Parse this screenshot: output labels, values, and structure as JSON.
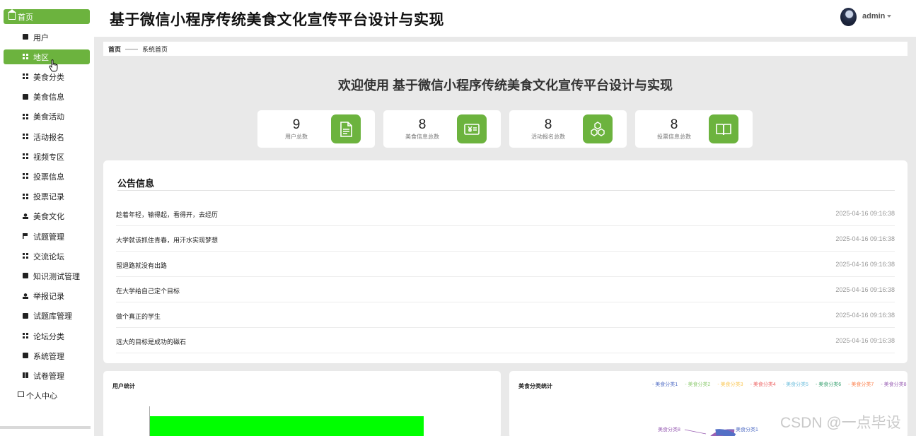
{
  "sidebar": {
    "home": "首页",
    "items": [
      {
        "label": "用户",
        "icon": "person-card-icon",
        "active": false
      },
      {
        "label": "地区",
        "icon": "grid-icon",
        "active": true
      },
      {
        "label": "美食分类",
        "icon": "grid-icon",
        "active": false
      },
      {
        "label": "美食信息",
        "icon": "thumbs-up-icon",
        "active": false
      },
      {
        "label": "美食活动",
        "icon": "grid-icon",
        "active": false
      },
      {
        "label": "活动报名",
        "icon": "grid-icon",
        "active": false
      },
      {
        "label": "视频专区",
        "icon": "grid-icon",
        "active": false
      },
      {
        "label": "投票信息",
        "icon": "grid-icon",
        "active": false
      },
      {
        "label": "投票记录",
        "icon": "grid-icon",
        "active": false
      },
      {
        "label": "美食文化",
        "icon": "user-icon",
        "active": false
      },
      {
        "label": "试题管理",
        "icon": "flag-icon",
        "active": false
      },
      {
        "label": "交流论坛",
        "icon": "grid-icon",
        "active": false
      },
      {
        "label": "知识测试管理",
        "icon": "clipboard-icon",
        "active": false
      },
      {
        "label": "举报记录",
        "icon": "user-stamp-icon",
        "active": false
      },
      {
        "label": "试题库管理",
        "icon": "database-icon",
        "active": false
      },
      {
        "label": "论坛分类",
        "icon": "grid-icon",
        "active": false
      },
      {
        "label": "系统管理",
        "icon": "chat-icon",
        "active": false
      },
      {
        "label": "试卷管理",
        "icon": "books-icon",
        "active": false
      }
    ],
    "personal": "个人中心"
  },
  "header": {
    "title": "基于微信小程序传统美食文化宣传平台设计与实现",
    "username": "admin"
  },
  "breadcrumb": {
    "first": "首页",
    "separator": "——",
    "current": "系统首页"
  },
  "welcome": "欢迎使用 基于微信小程序传统美食文化宣传平台设计与实现",
  "stats": [
    {
      "value": "9",
      "label": "用户总数",
      "icon": "document-icon"
    },
    {
      "value": "8",
      "label": "美食信息总数",
      "icon": "yen-bill-icon"
    },
    {
      "value": "8",
      "label": "活动报名总数",
      "icon": "cubes-icon"
    },
    {
      "value": "8",
      "label": "投票信息总数",
      "icon": "open-book-icon"
    }
  ],
  "notice": {
    "title": "公告信息",
    "rows": [
      {
        "text": "趁着年轻，输得起，看得开，去经历",
        "date": "2025-04-16 09:16:38"
      },
      {
        "text": "大学就该抓住青春，用汗水实现梦想",
        "date": "2025-04-16 09:16:38"
      },
      {
        "text": "留退路就没有出路",
        "date": "2025-04-16 09:16:38"
      },
      {
        "text": "在大学给自己定个目标",
        "date": "2025-04-16 09:16:38"
      },
      {
        "text": "做个真正的学生",
        "date": "2025-04-16 09:16:38"
      },
      {
        "text": "远大的目标是成功的磁石",
        "date": "2025-04-16 09:16:38"
      }
    ]
  },
  "panels": {
    "user_stats_title": "用户统计",
    "category_stats_title": "美食分类统计"
  },
  "colors": {
    "accent": "#6cb33e",
    "bar": "#00ff00"
  },
  "chart_data": [
    {
      "type": "bar",
      "title": "用户统计",
      "categories": [],
      "values": [],
      "note_visible": "single bar partially visible; values cut off"
    },
    {
      "type": "pie",
      "title": "美食分类统计",
      "legend": [
        "美食分类1",
        "美食分类2",
        "美食分类3",
        "美食分类4",
        "美食分类5",
        "美食分类6",
        "美食分类7",
        "美食分类8"
      ],
      "legend_colors": [
        "#5470c6",
        "#91cc75",
        "#fac858",
        "#ee6666",
        "#73c0de",
        "#3ba272",
        "#fc8452",
        "#9a60b4"
      ],
      "visible_labels": [
        "美食分类8",
        "美食分类1"
      ],
      "legend_position": "top-right"
    }
  ],
  "watermark": "CSDN @一点毕设"
}
